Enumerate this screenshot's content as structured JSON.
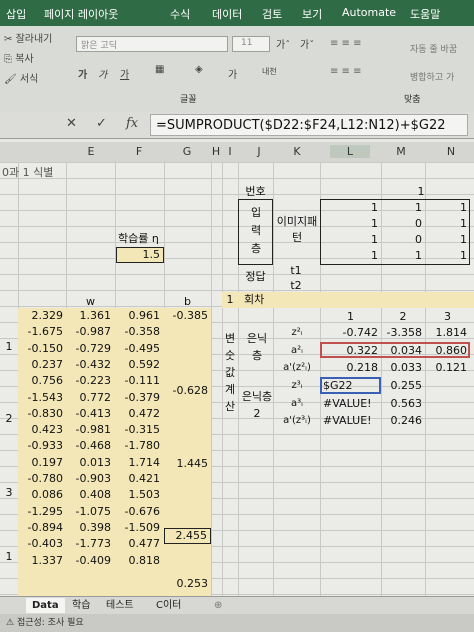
{
  "ribbon": {
    "tabs": [
      "삽입",
      "페이지 레이아웃",
      "수식",
      "데이터",
      "검토",
      "보기",
      "Automate",
      "도움말"
    ],
    "clipboard": {
      "cut": "잘라내기",
      "copy": "복사",
      "paste_fmt": "서식"
    },
    "font_name": "맑은 고딕",
    "font_size": "11",
    "group_font": "글꼴",
    "group_align": "맞춤",
    "wrap": "자동 줄 바꿈",
    "merge": "병합하고 가"
  },
  "formula_bar": {
    "fx": "fx",
    "formula": "=SUMPRODUCT($D22:$F24,L12:N12)+$G22"
  },
  "columns": [
    "E",
    "F",
    "G",
    "H",
    "I",
    "J",
    "K",
    "L",
    "M",
    "N"
  ],
  "sheet": {
    "title_fragment": "0과 1 식별",
    "learning_rate_label": "학습률 η",
    "learning_rate": "1.5",
    "w_label": "w",
    "b_label": "b",
    "row_groups": [
      "1",
      "2",
      "3",
      "1"
    ],
    "w": [
      [
        "2.329",
        "1.361",
        "0.961"
      ],
      [
        "-1.675",
        "-0.987",
        "-0.358"
      ],
      [
        "-0.150",
        "-0.729",
        "-0.495"
      ],
      [
        "0.237",
        "-0.432",
        "0.592"
      ],
      [
        "0.756",
        "-0.223",
        "-0.111"
      ],
      [
        "-1.543",
        "0.772",
        "-0.379"
      ],
      [
        "-0.830",
        "-0.413",
        "0.472"
      ],
      [
        "0.423",
        "-0.981",
        "-0.315"
      ],
      [
        "-0.933",
        "-0.468",
        "-1.780"
      ],
      [
        "0.197",
        "0.013",
        "1.714"
      ],
      [
        "-0.780",
        "-0.903",
        "0.421"
      ],
      [
        "0.086",
        "0.408",
        "1.503"
      ],
      [
        "-1.295",
        "-1.075",
        "-0.676"
      ],
      [
        "-0.894",
        "0.398",
        "-1.509"
      ],
      [
        "-0.403",
        "-1.773",
        "0.477"
      ],
      [
        "1.337",
        "-0.409",
        "0.818"
      ]
    ],
    "b": [
      "-0.385",
      "-0.628",
      "1.445",
      "2.455",
      "0.253"
    ],
    "number_label": "번호",
    "number_val": "1",
    "input_layer": "입력층",
    "image_label": "이미지패턴",
    "image_matrix": [
      [
        "1",
        "1",
        "1"
      ],
      [
        "1",
        "0",
        "1"
      ],
      [
        "1",
        "0",
        "1"
      ],
      [
        "1",
        "1",
        "1"
      ]
    ],
    "answer_label": "정답",
    "t1": "t1",
    "t2": "t2",
    "round_num": "1",
    "round_label": "회차",
    "var_label": "변숫값계산",
    "hidden_layer": "은닉층",
    "hidden_layer2": "은닉층2",
    "neuron_idx": [
      "1",
      "2",
      "3"
    ],
    "row_labels": [
      "z²ᵢ",
      "a²ᵢ",
      "a'(z²ᵢ)",
      "z³ᵢ",
      "a³ᵢ",
      "a'(z³ᵢ)"
    ],
    "hidden_vals": [
      [
        "-0.742",
        "-3.358",
        "1.814"
      ],
      [
        "0.322",
        "0.034",
        "0.860"
      ],
      [
        "0.218",
        "0.033",
        "0.121"
      ]
    ],
    "hidden2_vals": [
      [
        "$G22",
        "0.255"
      ],
      [
        "#VALUE!",
        "0.563"
      ],
      [
        "#VALUE!",
        "0.246"
      ]
    ]
  },
  "sheet_tabs": [
    "Data",
    "학습",
    "테스트",
    "C이터"
  ],
  "status": "접근성: 조사 필요"
}
